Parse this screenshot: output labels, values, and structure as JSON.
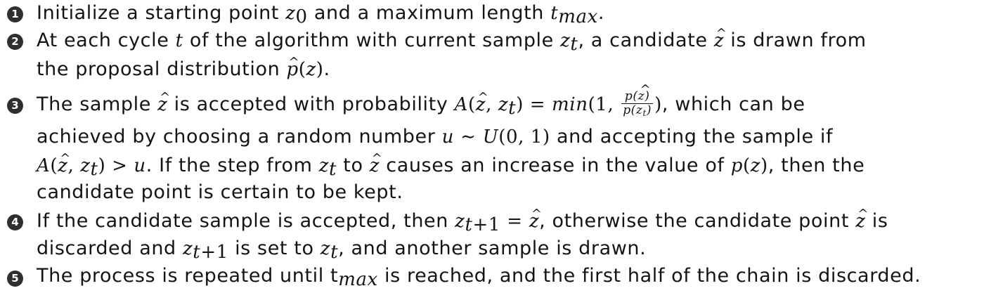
{
  "steps": [
    {
      "number": "1",
      "lines": [
        "Initialize a starting point z₀ and a maximum length tₘₐₓ."
      ]
    },
    {
      "number": "2",
      "lines": [
        "At each cycle t of the algorithm with current sample zₜ, a candidate ẑ is drawn from",
        "the proposal distribution p̂(z)."
      ]
    },
    {
      "number": "3",
      "lines": [
        "The sample ẑ is accepted with probability A(ẑ, zₜ) = min(1, p(ẑ)/p(zₜ)), which can be",
        "achieved by choosing a random number u ∼ U(0, 1) and accepting the sample if",
        "A(ẑ, zₜ) > u. If the step from zₜ to ẑ causes an increase in the value of p(z), then the",
        "candidate point is certain to be kept."
      ]
    },
    {
      "number": "4",
      "lines": [
        "If the candidate sample is accepted, then zₜ₊₁ = ẑ, otherwise the candidate point ẑ is",
        "discarded and zₜ₊₁ is set to zₜ, and another sample is drawn."
      ]
    },
    {
      "number": "5",
      "lines": [
        "The process is repeated until tₘₐₓ is reached, and the first half of the chain is discarded."
      ]
    }
  ]
}
